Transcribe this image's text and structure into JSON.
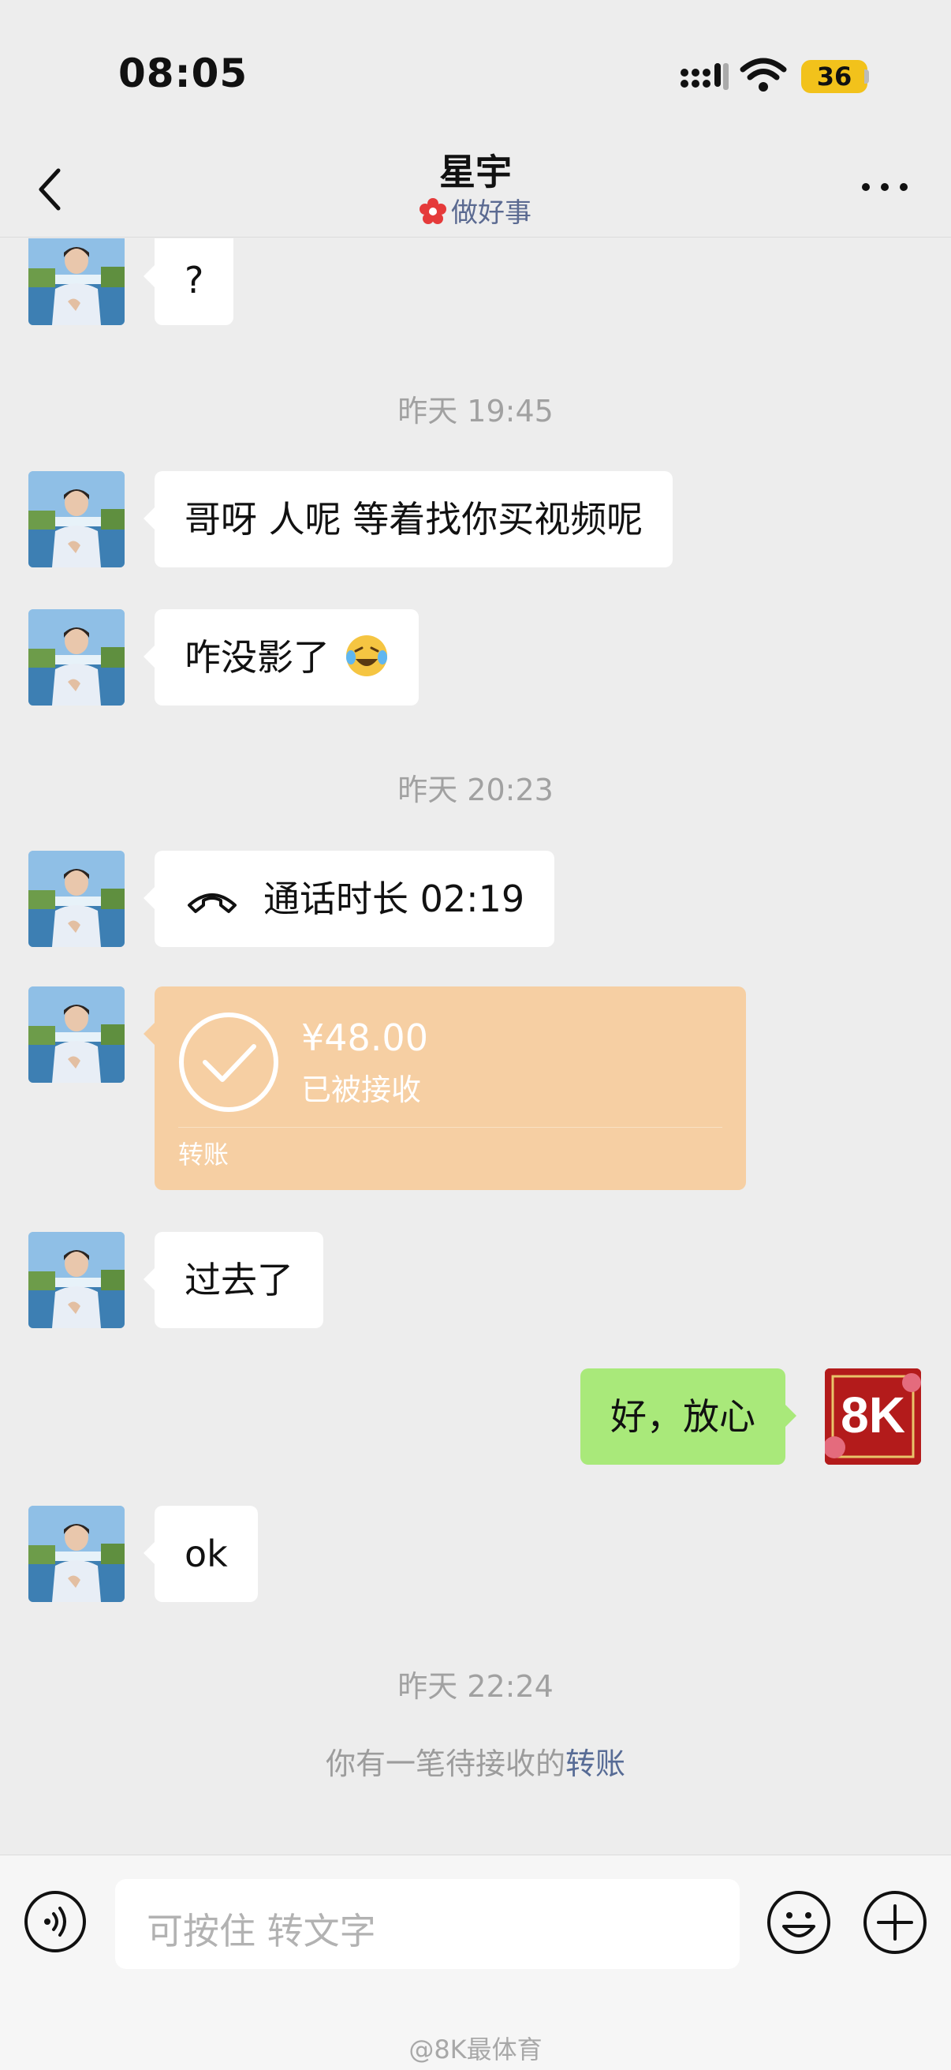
{
  "status_bar": {
    "time": "08:05",
    "battery": "36"
  },
  "header": {
    "title": "星宇",
    "status": "做好事"
  },
  "messages": [
    {
      "text": "?"
    },
    {
      "timestamp": "昨天 19:45"
    },
    {
      "text": "哥呀 人呢 等着找你买视频呢"
    },
    {
      "text": "咋没影了"
    },
    {
      "timestamp": "昨天 20:23"
    },
    {
      "text": "通话时长 02:19"
    },
    {
      "transfer_amount": "¥48.00",
      "transfer_status": "已被接收",
      "transfer_label": "转账"
    },
    {
      "text": "过去了"
    },
    {
      "text": "好，放心",
      "avatar_label": "8K"
    },
    {
      "text": "ok"
    },
    {
      "timestamp": "昨天 22:24"
    },
    {
      "note_prefix": "你有一笔待接收的",
      "note_link": "转账"
    }
  ],
  "input_bar": {
    "placeholder": "可按住 转文字"
  },
  "watermark": "@8K最体育",
  "colors": {
    "background": "#ededed",
    "self_bubble": "#a9e97a",
    "transfer_card": "#f6cfa3",
    "link": "#576b95",
    "battery": "#f2c21b"
  }
}
